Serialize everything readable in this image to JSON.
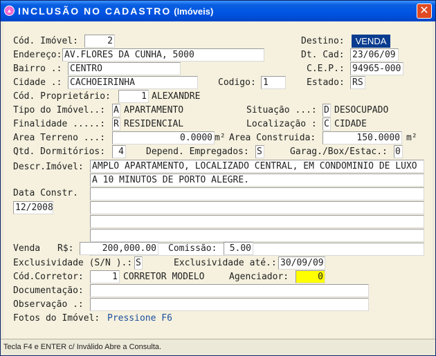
{
  "window": {
    "title": "INCLUSÃO NO CADASTRO",
    "subtitle": "(Imóveis)",
    "close_glyph": "✕",
    "icon": "app-icon"
  },
  "form": {
    "cod_imovel": {
      "label": "Cód. Imóvel:",
      "value": "2"
    },
    "destino": {
      "label": "Destino:",
      "value": "VENDA"
    },
    "endereco": {
      "label": "Endereço:",
      "value": "AV.FLORES DA CUNHA, 5000"
    },
    "dt_cad": {
      "label": "Dt. Cad:",
      "value": "23/06/09"
    },
    "bairro": {
      "label": "Bairro .:",
      "value": "CENTRO"
    },
    "cep": {
      "label": "C.E.P.:",
      "value": "94965-000"
    },
    "cidade": {
      "label": "Cidade .:",
      "value": "CACHOEIRINHA"
    },
    "codigo": {
      "label": "Codigo:",
      "value": "1"
    },
    "estado": {
      "label": "Estado:",
      "value": "RS"
    },
    "cod_proprietario": {
      "label": "Cód. Proprietário:",
      "value": "1",
      "name": "ALEXANDRE"
    },
    "tipo_imovel": {
      "label": "Tipo do Imóvel..:",
      "code": "A",
      "desc": "APARTAMENTO"
    },
    "situacao": {
      "label": "Situação ...:",
      "code": "D",
      "desc": "DESOCUPADO"
    },
    "finalidade": {
      "label": "Finalidade .....:",
      "code": "R",
      "desc": "RESIDENCIAL"
    },
    "localizacao": {
      "label": "Localização :",
      "code": "C",
      "desc": "CIDADE"
    },
    "area_terreno": {
      "label": "Area Terreno ...:",
      "value": "0.0000",
      "unit": "m²"
    },
    "area_construida": {
      "label": "Area Construida:",
      "value": "150.0000",
      "unit": "m²"
    },
    "qtd_dormitorios": {
      "label": "Qtd. Dormitórios:",
      "value": "4"
    },
    "depend_empregados": {
      "label": "Depend. Empregados:",
      "value": "S"
    },
    "garagem": {
      "label": "Garag./Box/Estac.:",
      "value": "0"
    },
    "descr_imovel": {
      "label": "Descr.Imóvel:",
      "lines": [
        "AMPLO APARTAMENTO, LOCALIZADO CENTRAL, EM CONDOMINIO DE LUXO",
        "A 10 MINUTOS DE PORTO ALEGRE.",
        "",
        "",
        "",
        "",
        ""
      ]
    },
    "data_constr": {
      "label": "Data Constr.",
      "value": "12/2008"
    },
    "venda": {
      "label": "Venda",
      "currency": "R$:",
      "value": "200,000.00"
    },
    "comissao": {
      "label": "Comissão:",
      "value": "5.00"
    },
    "exclusividade": {
      "label": "Exclusividade (S/N ).:",
      "value": "S"
    },
    "exclusividade_ate": {
      "label": "Exclusividade até.:",
      "value": "30/09/09"
    },
    "cod_corretor": {
      "label": "Cód.Corretor:",
      "value": "1",
      "name": "CORRETOR MODELO"
    },
    "agenciador": {
      "label": "Agenciador:",
      "value": "0"
    },
    "documentacao": {
      "label": "Documentação:",
      "value": ""
    },
    "observacao": {
      "label": "Observação .:",
      "value": ""
    },
    "fotos": {
      "label": "Fotos do Imóvel:",
      "link": "Pressione F6"
    }
  },
  "statusbar": {
    "text": "Tecla F4 e ENTER c/ Inválido Abre a Consulta."
  },
  "colors": {
    "selected": "#0a3d8f",
    "highlight": "#ffff00",
    "titlebar": "#0054e3",
    "close": "#e04a23"
  }
}
